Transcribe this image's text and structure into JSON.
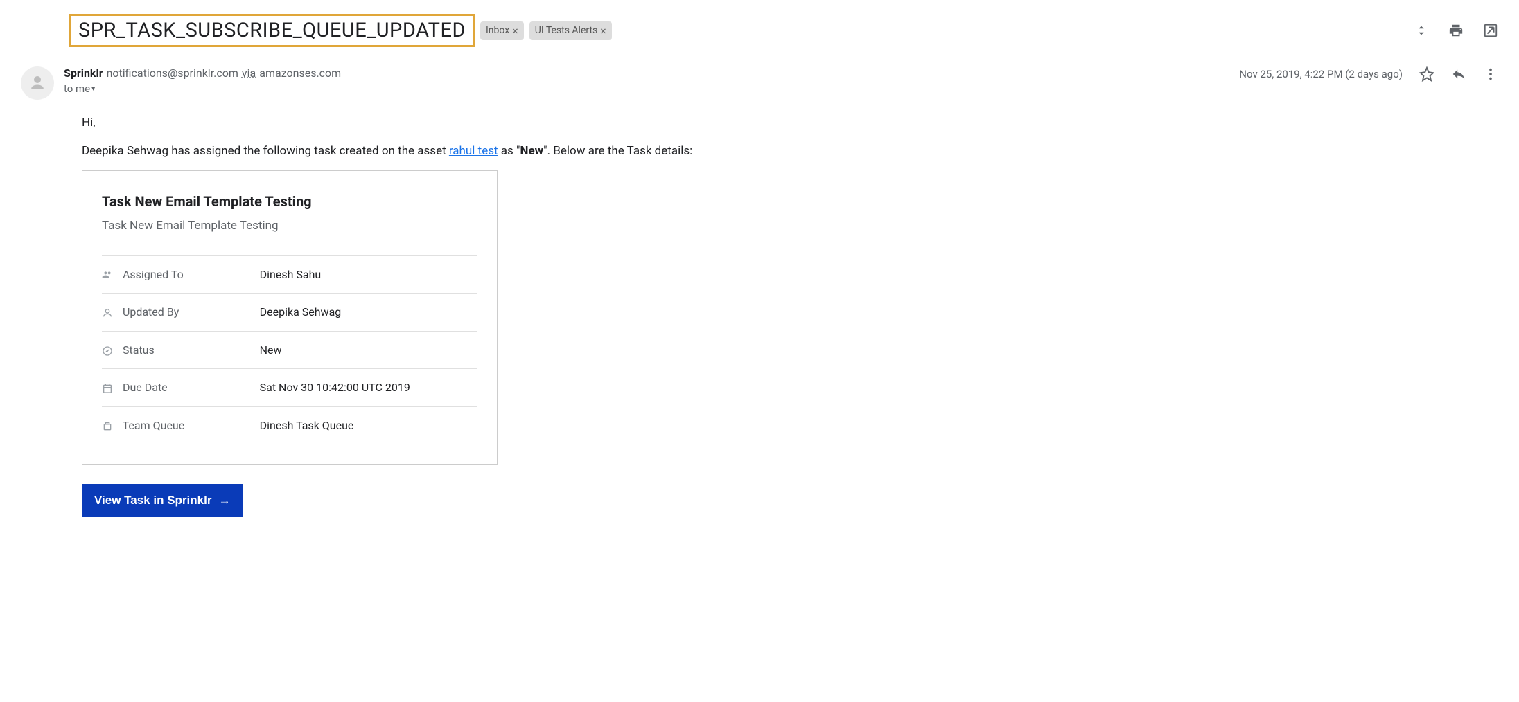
{
  "subject": "SPR_TASK_SUBSCRIBE_QUEUE_UPDATED",
  "labels": [
    "Inbox",
    "UI Tests Alerts"
  ],
  "from": {
    "name": "Sprinklr",
    "email": "notifications@sprinklr.com",
    "via_label": "via",
    "via_domain": "amazonses.com"
  },
  "timestamp": "Nov 25, 2019, 4:22 PM (2 days ago)",
  "to_line": "to me",
  "body": {
    "greeting": "Hi,",
    "line1_pre": "Deepika Sehwag has assigned the following task created on the asset ",
    "line1_link": "rahul test",
    "line1_mid": " as \"",
    "line1_bold": "New",
    "line1_post": "\". Below are the Task details:"
  },
  "task": {
    "title": "Task New Email Template Testing",
    "subtitle": "Task New Email Template Testing",
    "rows": [
      {
        "icon": "people",
        "label": "Assigned To",
        "value": "Dinesh Sahu"
      },
      {
        "icon": "person",
        "label": "Updated By",
        "value": "Deepika Sehwag"
      },
      {
        "icon": "status",
        "label": "Status",
        "value": "New"
      },
      {
        "icon": "calendar",
        "label": "Due Date",
        "value": "Sat Nov 30 10:42:00 UTC 2019"
      },
      {
        "icon": "queue",
        "label": "Team Queue",
        "value": "Dinesh Task Queue"
      }
    ]
  },
  "cta": {
    "label": "View Task in Sprinklr",
    "arrow": "→"
  }
}
